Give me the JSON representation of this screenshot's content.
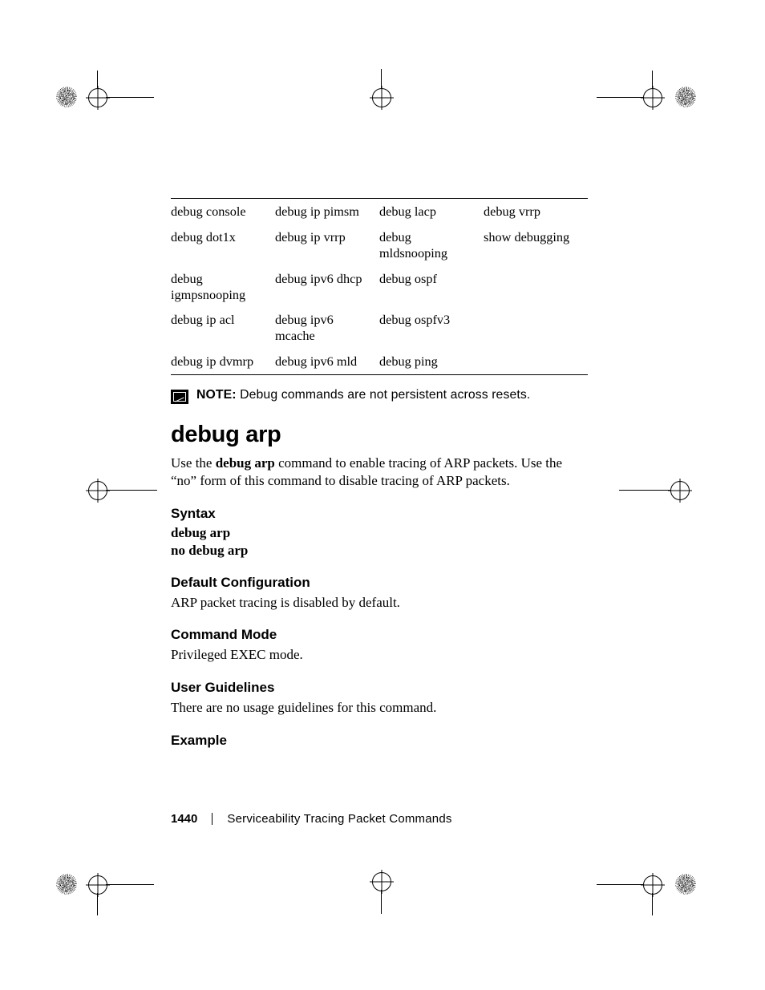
{
  "table": {
    "rows": [
      [
        "debug console",
        "debug ip pimsm",
        "debug lacp",
        "debug vrrp"
      ],
      [
        "debug dot1x",
        "debug ip vrrp",
        "debug mldsnooping",
        "show debugging"
      ],
      [
        "debug igmpsnooping",
        "debug ipv6 dhcp",
        "debug ospf",
        ""
      ],
      [
        "debug ip acl",
        "debug ipv6 mcache",
        "debug ospfv3",
        ""
      ],
      [
        "debug ip dvmrp",
        "debug ipv6 mld",
        "debug ping",
        ""
      ]
    ]
  },
  "note": {
    "label": "NOTE:",
    "text": "Debug commands are not persistent across resets."
  },
  "command": {
    "title": "debug arp",
    "description_pre": "Use the ",
    "description_bold": "debug arp",
    "description_post": " command to enable tracing of ARP packets. Use the “no” form of this command to disable tracing of ARP packets."
  },
  "sections": {
    "syntax": {
      "heading": "Syntax",
      "lines": [
        "debug arp",
        "no debug arp"
      ]
    },
    "default_cfg": {
      "heading": "Default Configuration",
      "body": "ARP packet tracing is disabled by default."
    },
    "cmd_mode": {
      "heading": "Command Mode",
      "body": "Privileged EXEC mode."
    },
    "guidelines": {
      "heading": "User Guidelines",
      "body": "There are no usage guidelines for this command."
    },
    "example": {
      "heading": "Example"
    }
  },
  "footer": {
    "page": "1440",
    "chapter": "Serviceability Tracing Packet Commands"
  }
}
